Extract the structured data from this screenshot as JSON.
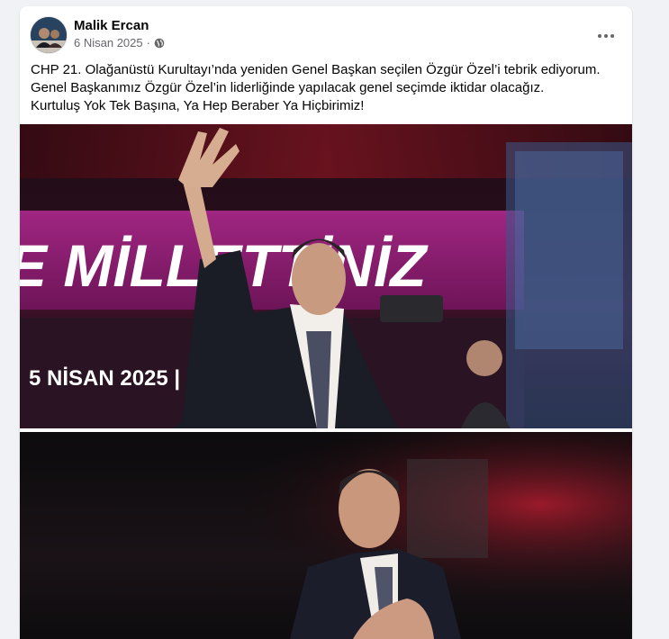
{
  "post": {
    "author": "Malik Ercan",
    "date": "6 Nisan 2025",
    "separator": "·",
    "privacy_icon": "globe-icon",
    "more_icon": "ellipsis-icon",
    "text_lines": [
      "CHP 21. Olağanüstü Kurultayı’nda yeniden Genel Başkan seçilen Özgür Özel’i tebrik ediyorum.",
      "Genel Başkanımız Özgür Özel’in liderliğinde yapılacak genel seçimde iktidar olacağız.",
      "Kurtuluş Yok Tek Başına, Ya Hep Beraber Ya Hiçbirimiz!"
    ]
  },
  "photos": [
    {
      "banner_text": "E MİLLETTİNİZ",
      "date_text": "5 NİSAN 2025  |  ANKARA"
    },
    {}
  ],
  "colors": {
    "banner_magenta": "#8c1e6e",
    "text": "#050505",
    "secondary": "#65676b"
  }
}
